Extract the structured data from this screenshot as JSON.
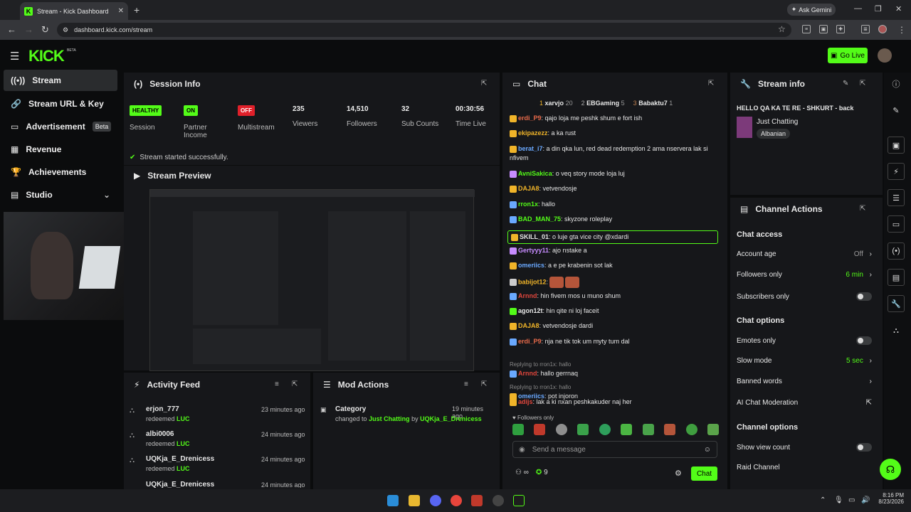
{
  "browser": {
    "tab_title": "Stream - Kick Dashboard",
    "url": "dashboard.kick.com/stream",
    "gemini": "Ask Gemini"
  },
  "header": {
    "logo": "KICK",
    "beta": "BETA",
    "go_live": "Go Live"
  },
  "sidebar": {
    "items": [
      {
        "label": "Stream",
        "icon": "broadcast-icon"
      },
      {
        "label": "Stream URL & Key",
        "icon": "link-icon"
      },
      {
        "label": "Advertisement",
        "icon": "ad-icon",
        "badge": "Beta"
      },
      {
        "label": "Revenue",
        "icon": "revenue-icon"
      },
      {
        "label": "Achievements",
        "icon": "trophy-icon"
      },
      {
        "label": "Studio",
        "icon": "studio-icon"
      }
    ]
  },
  "session": {
    "title": "Session Info",
    "stats": [
      {
        "pill": "HEALTHY",
        "label": "Session"
      },
      {
        "pill": "ON",
        "label": "Partner Income"
      },
      {
        "pill": "OFF",
        "label": "Multistream"
      },
      {
        "value": "235",
        "label": "Viewers"
      },
      {
        "value": "14,510",
        "label": "Followers"
      },
      {
        "value": "32",
        "label": "Sub Counts"
      },
      {
        "value": "00:30:56",
        "label": "Time Live"
      }
    ],
    "status": "Stream started successfully."
  },
  "preview": {
    "title": "Stream Preview"
  },
  "activity": {
    "title": "Activity Feed",
    "rows": [
      {
        "user": "erjon_777",
        "action": "redeemed",
        "item": "LUC",
        "time": "23 minutes ago"
      },
      {
        "user": "albi0006",
        "action": "redeemed",
        "item": "LUC",
        "time": "24 minutes ago"
      },
      {
        "user": "UQKja_E_Drenicess",
        "action": "redeemed",
        "item": "LUC",
        "time": "24 minutes ago"
      },
      {
        "user": "UQKja_E_Drenicess",
        "action": "",
        "item": "",
        "time": "24 minutes ago"
      }
    ]
  },
  "mod": {
    "title": "Mod Actions",
    "rows": [
      {
        "label": "Category",
        "prefix": "changed to",
        "value": "Just Chatting",
        "by": "by",
        "user": "UQKja_E_Drenicess",
        "time": "19 minutes ago"
      }
    ]
  },
  "chat": {
    "title": "Chat",
    "leaders": [
      {
        "rank": "1",
        "user": "xarvjo",
        "count": "20"
      },
      {
        "rank": "2",
        "user": "EBGaming",
        "count": "5"
      },
      {
        "rank": "3",
        "user": "Babaktu7",
        "count": "1"
      }
    ],
    "messages": [
      {
        "user": "erdi_P9",
        "color": "#e86a4a",
        "text": ": qajo loja me peshk shum e fort ish"
      },
      {
        "user": "ekipazezz",
        "color": "#f0b429",
        "text": ": a ka rust"
      },
      {
        "user": "berat_i7",
        "color": "#6aa9ff",
        "text": ": a din qka lun, red dead redemption 2 ama nservera lak si nfivem"
      },
      {
        "user": "AvniSakica",
        "color": "#53fc18",
        "text": ": o veq story mode loja luj"
      },
      {
        "user": "DAJA8",
        "color": "#f0b429",
        "text": ": vetvendosje"
      },
      {
        "user": "rron1x",
        "color": "#53fc18",
        "text": ": hallo"
      },
      {
        "user": "BAD_MAN_75",
        "color": "#53fc18",
        "text": ": skyzone roleplay"
      },
      {
        "user": "SKILL_01",
        "color": "#e8e8e8",
        "text": ": o luje gta vice city @xdardi"
      },
      {
        "user": "Gertyyy11",
        "color": "#c78cff",
        "text": ": ajo nstake a"
      },
      {
        "user": "omeriics",
        "color": "#6aa9ff",
        "text": ": a e pe krabenin sot lak"
      },
      {
        "user": "babijot12",
        "color": "#f0b429",
        "text": ":"
      },
      {
        "user": "Arnnd",
        "color": "#e0463c",
        "text": ": hin fivem mos u muno shum"
      },
      {
        "user": "agon12t",
        "color": "#e8e8e8",
        "text": ": hin qite ni loj faceit"
      },
      {
        "user": "DAJA8",
        "color": "#f0b429",
        "text": ": vetvendosje dardi"
      },
      {
        "user": "erdi_P9",
        "color": "#e86a4a",
        "text": ": nja ne tik tok um myty tum dal"
      },
      {
        "user": "Arnnd",
        "color": "#e0463c",
        "text": ": hallo gerrnaq",
        "reply": "Replying to rron1x: hallo"
      },
      {
        "user": "omeriics",
        "color": "#6aa9ff",
        "text": ": pot injoron",
        "reply": "Replying to rron1x: hallo"
      },
      {
        "user": "adijs",
        "color": "#e0463c",
        "text": ": lak a ki nxan peshkakuder naj her"
      }
    ],
    "followers_only": "Followers only",
    "placeholder": "Send a message",
    "infinity": "∞",
    "count": "9",
    "send": "Chat"
  },
  "stream_info": {
    "title": "Stream info",
    "stream_title": "HELLO QA KA TE RE - SHKURT - back",
    "category": "Just Chatting",
    "tag": "Albanian"
  },
  "channel_actions": {
    "title": "Channel Actions",
    "chat_access": "Chat access",
    "account_age": "Account age",
    "account_age_value": "Off",
    "followers_only": "Followers only",
    "followers_only_value": "6 min",
    "subscribers_only": "Subscribers only",
    "chat_options": "Chat options",
    "emotes_only": "Emotes only",
    "slow_mode": "Slow mode",
    "slow_mode_value": "5 sec",
    "banned_words": "Banned words",
    "ai_moderation": "AI Chat Moderation",
    "channel_options": "Channel options",
    "show_view_count": "Show view count",
    "raid_channel": "Raid Channel"
  },
  "taskbar": {
    "time": "8:16 PM",
    "date": "8/23/2026"
  },
  "colors": {
    "accent": "#53fc18",
    "panel": "#16171a",
    "bg": "#0b0c0d"
  }
}
